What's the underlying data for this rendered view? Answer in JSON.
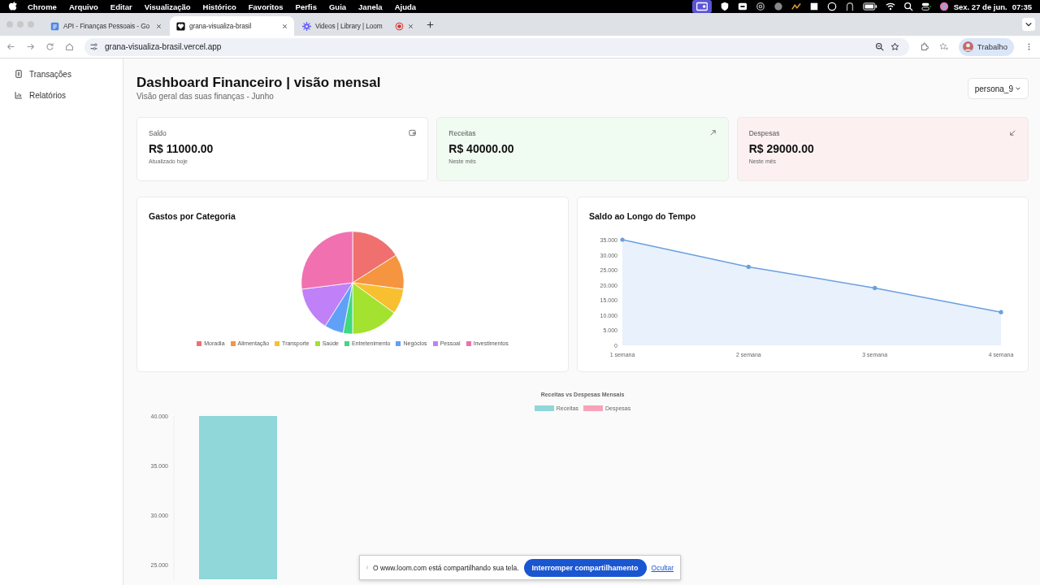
{
  "menubar": {
    "app": "Chrome",
    "menus": [
      "Arquivo",
      "Editar",
      "Visualização",
      "Histórico",
      "Favoritos",
      "Perfis",
      "Guia",
      "Janela",
      "Ajuda"
    ],
    "date": "Sex. 27 de jun.",
    "time": "07:35"
  },
  "tabs": [
    {
      "title": "API - Finanças Pessoais - Go",
      "selected": false,
      "kind": "doc"
    },
    {
      "title": "grana-visualiza-brasil",
      "selected": true,
      "kind": "heart"
    },
    {
      "title": "Videos | Library | Loom",
      "selected": false,
      "kind": "loom"
    }
  ],
  "address_bar": {
    "url": "grana-visualiza-brasil.vercel.app",
    "profile": "Trabalho"
  },
  "sidebar": {
    "items": [
      {
        "label": "Transações",
        "kind": "receipt"
      },
      {
        "label": "Relatórios",
        "kind": "chart"
      }
    ]
  },
  "header": {
    "title": "Dashboard Financeiro | visão mensal",
    "subtitle": "Visão geral das suas finanças - Junho",
    "persona": "persona_9"
  },
  "cards": [
    {
      "label": "Saldo",
      "value": "R$ 11000.00",
      "note": "Atualizado hoje",
      "kind": "balance"
    },
    {
      "label": "Receitas",
      "value": "R$ 40000.00",
      "note": "Neste mês",
      "kind": "income"
    },
    {
      "label": "Despesas",
      "value": "R$ 29000.00",
      "note": "Neste mês",
      "kind": "expense"
    }
  ],
  "category_chart": {
    "title": "Gastos por Categoria",
    "chart_data": {
      "type": "pie",
      "legend": "bottom",
      "categories": [
        "Moradia",
        "Alimentação",
        "Transporte",
        "Saúde",
        "Entretenimento",
        "Negócios",
        "Pessoal",
        "Investimentos"
      ],
      "series": [
        {
          "colors": [
            "#f07070",
            "#f59540",
            "#f8c030",
            "#a3e22e",
            "#40d880",
            "#60a0f8",
            "#c080f8",
            "#f070b0"
          ],
          "values": [
            16,
            11,
            8,
            15,
            3,
            6,
            14,
            27
          ]
        }
      ]
    }
  },
  "balance_chart": {
    "title": "Saldo ao Longo do Tempo",
    "chart_data": {
      "type": "area",
      "categories": [
        "1 semana",
        "2 semana",
        "3 semana",
        "4 semana"
      ],
      "series": [
        {
          "color": "#6aa0e0",
          "values": [
            35,
            26,
            19,
            11
          ]
        }
      ],
      "ylim": [
        0,
        35
      ],
      "yticks": [
        {
          "value": 0,
          "label": "0"
        },
        {
          "value": 5,
          "label": "5.000"
        },
        {
          "value": 10,
          "label": "10.000"
        },
        {
          "value": 15,
          "label": "15.000"
        },
        {
          "value": 20,
          "label": "20.000"
        },
        {
          "value": 25,
          "label": "25.000"
        },
        {
          "value": 30,
          "label": "30.000"
        },
        {
          "value": 35,
          "label": "35.000"
        }
      ]
    }
  },
  "monthly_chart": {
    "title": "Receitas vs Despesas Mensais",
    "chart_data": {
      "type": "bar",
      "legend": "top",
      "series": [
        {
          "name": "Receitas",
          "color": "#8fd7d9",
          "values": [
            40
          ]
        },
        {
          "name": "Despesas",
          "color": "#f6a3b9",
          "values": [
            null
          ]
        }
      ],
      "ylim": [
        23.5,
        40
      ],
      "yticks": [
        {
          "value": 25,
          "label": "25.000"
        },
        {
          "value": 30,
          "label": "30.000"
        },
        {
          "value": 35,
          "label": "35.000"
        },
        {
          "value": 40,
          "label": "40.000"
        }
      ]
    }
  },
  "share_bar": {
    "message": "O www.loom.com está compartilhando sua tela.",
    "stop_button": "Interromper compartilhamento",
    "hide_link": "Ocultar"
  }
}
